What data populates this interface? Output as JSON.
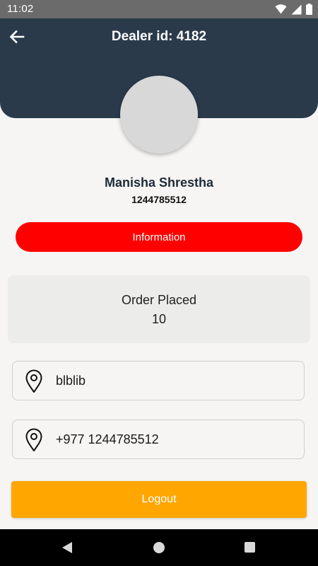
{
  "status_bar": {
    "time": "11:02",
    "icons": [
      "wifi-icon",
      "signal-icon",
      "battery-icon"
    ]
  },
  "header": {
    "title": "Dealer id: 4182",
    "back_icon": "arrow-left-icon",
    "background_color": "#2a3a4b"
  },
  "profile": {
    "name": "Manisha Shrestha",
    "phone": "1244785512"
  },
  "info_button": {
    "label": "Information",
    "color": "#ff0000"
  },
  "order_card": {
    "label": "Order Placed",
    "count": "10"
  },
  "fields": [
    {
      "icon": "location-pin-icon",
      "value": "blblib"
    },
    {
      "icon": "location-pin-icon",
      "value": "+977 1244785512"
    }
  ],
  "logout_button": {
    "label": "Logout",
    "color": "#ffa600"
  },
  "nav_bar": {
    "items": [
      "nav-back-icon",
      "nav-home-icon",
      "nav-recents-icon"
    ]
  }
}
